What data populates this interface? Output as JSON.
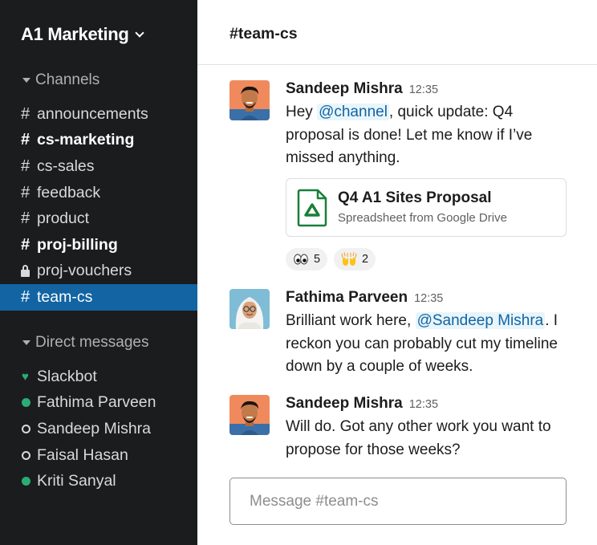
{
  "workspace": {
    "name": "A1 Marketing"
  },
  "sidebar": {
    "channels_label": "Channels",
    "channels": [
      {
        "name": "announcements",
        "icon": "hash-icon",
        "bold": false,
        "active": false
      },
      {
        "name": "cs-marketing",
        "icon": "hash-icon",
        "bold": true,
        "active": false
      },
      {
        "name": "cs-sales",
        "icon": "hash-icon",
        "bold": false,
        "active": false
      },
      {
        "name": "feedback",
        "icon": "hash-icon",
        "bold": false,
        "active": false
      },
      {
        "name": "product",
        "icon": "hash-icon",
        "bold": false,
        "active": false
      },
      {
        "name": "proj-billing",
        "icon": "hash-icon",
        "bold": true,
        "active": false
      },
      {
        "name": "proj-vouchers",
        "icon": "lock-icon",
        "bold": false,
        "active": false
      },
      {
        "name": "team-cs",
        "icon": "hash-icon",
        "bold": false,
        "active": true
      }
    ],
    "dm_label": "Direct messages",
    "direct_messages": [
      {
        "name": "Slackbot",
        "status": "heart-icon"
      },
      {
        "name": "Fathima Parveen",
        "status": "online"
      },
      {
        "name": "Sandeep Mishra",
        "status": "away"
      },
      {
        "name": "Faisal Hasan",
        "status": "away"
      },
      {
        "name": "Kriti Sanyal",
        "status": "online"
      }
    ]
  },
  "header": {
    "hash": "#",
    "channel": "team-cs"
  },
  "messages": [
    {
      "author": "Sandeep Mishra",
      "time": "12:35",
      "text_before": "Hey ",
      "mention": "@channel",
      "text_after": ", quick update: Q4 proposal is done! Let me know if I’ve missed anything.",
      "attachment": {
        "title": "Q4 A1 Sites Proposal",
        "subtitle": "Spreadsheet from Google Drive",
        "icon": "google-drive-icon"
      },
      "reactions": [
        {
          "emoji": "eyes-icon",
          "count": "5"
        },
        {
          "emoji": "raised-hands-icon",
          "count": "2"
        }
      ]
    },
    {
      "author": "Fathima Parveen",
      "time": "12:35",
      "text_before": "Brilliant work here, ",
      "mention": "@Sandeep Mishra",
      "text_after": ". I reckon you can probably cut my timeline down by a couple of weeks."
    },
    {
      "author": "Sandeep Mishra",
      "time": "12:35",
      "text": "Will do. Got any other work you want to propose for those weeks?"
    }
  ],
  "composer": {
    "placeholder": "Message #team-cs"
  },
  "colors": {
    "sidebar_bg": "#1b1c1d",
    "active_item": "#1264a3",
    "online": "#2bac76",
    "mention_bg": "#e8f5fa",
    "mention_text": "#1264a3",
    "drive_green": "#188038"
  }
}
